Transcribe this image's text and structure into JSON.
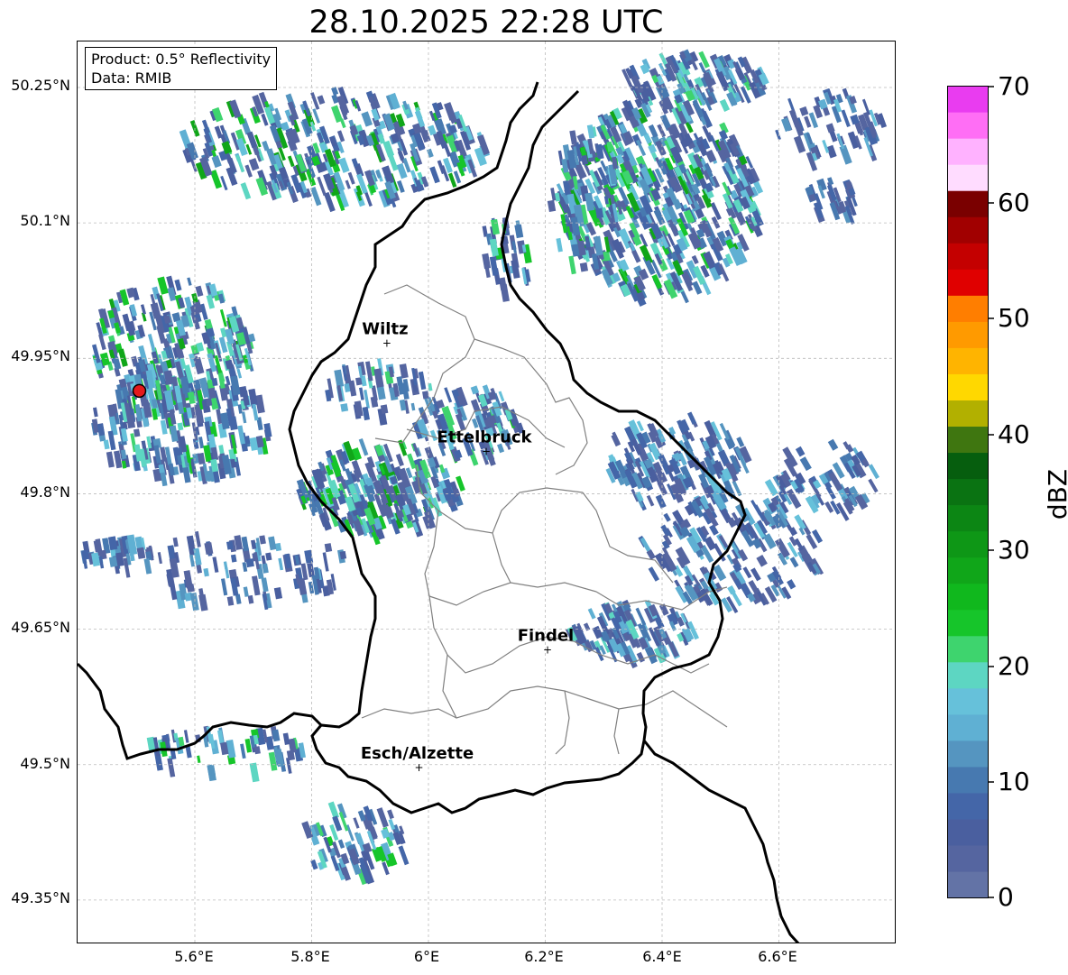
{
  "title": "28.10.2025 22:28 UTC",
  "info": {
    "product": "Product: 0.5° Reflectivity",
    "data": "Data: RMIB"
  },
  "lat_labels": [
    "50.25°N",
    "50.1°N",
    "49.95°N",
    "49.8°N",
    "49.65°N",
    "49.5°N",
    "49.35°N"
  ],
  "lon_labels": [
    "5.6°E",
    "5.8°E",
    "6°E",
    "6.2°E",
    "6.4°E",
    "6.6°E"
  ],
  "cities": [
    {
      "name": "Wiltz",
      "lon": 5.935,
      "lat": 49.967
    },
    {
      "name": "Ettelbruck",
      "lon": 6.105,
      "lat": 49.847
    },
    {
      "name": "Findel",
      "lon": 6.21,
      "lat": 49.627
    },
    {
      "name": "Esch/Alzette",
      "lon": 5.99,
      "lat": 49.497
    }
  ],
  "radar_site": {
    "lon": 5.505,
    "lat": 49.914
  },
  "colorbar": {
    "label": "dBZ",
    "min": 0,
    "max": 70,
    "tick_labels": [
      "70",
      "60",
      "50",
      "40",
      "30",
      "20",
      "10",
      "0"
    ],
    "colors": [
      "#6373a6",
      "#5565a0",
      "#4a5f9f",
      "#4466a8",
      "#4779b0",
      "#5595c0",
      "#5fb0d3",
      "#66c1da",
      "#5dd6c2",
      "#3ed46e",
      "#16c52a",
      "#10b81d",
      "#10a619",
      "#0e9716",
      "#0c8614",
      "#0a7312",
      "#065e0e",
      "#3f7610",
      "#b2b000",
      "#ffd800",
      "#ffb400",
      "#ff9a00",
      "#ff7e00",
      "#e00000",
      "#c40000",
      "#a10000",
      "#7a0000",
      "#ffdcff",
      "#ffb2ff",
      "#ff6ef5",
      "#e93cf0"
    ]
  },
  "map_colors": {
    "border": "#000000",
    "canton": "#808080",
    "grid": "#bbbbbb",
    "site": "#e41a1c"
  }
}
